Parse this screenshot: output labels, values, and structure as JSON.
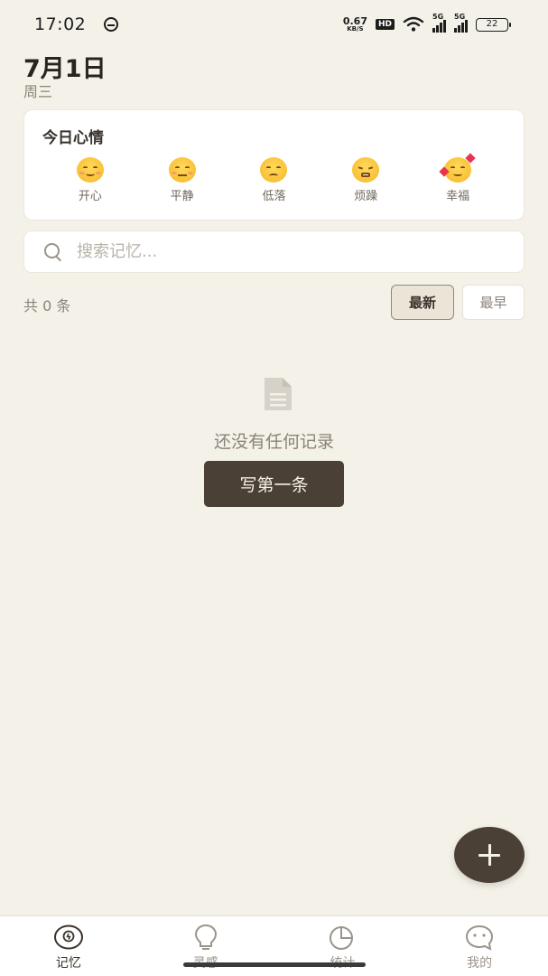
{
  "status_bar": {
    "time": "17:02",
    "net_speed": "0.67",
    "net_unit": "KB/S",
    "hd": "HD",
    "sig1": "5G",
    "sig2": "5G",
    "battery": "22"
  },
  "header": {
    "date": "7月1日",
    "weekday": "周三"
  },
  "mood": {
    "title": "今日心情",
    "items": [
      {
        "label": "开心",
        "icon": "smiling-face-icon"
      },
      {
        "label": "平静",
        "icon": "relieved-face-icon"
      },
      {
        "label": "低落",
        "icon": "pensive-face-icon"
      },
      {
        "label": "烦躁",
        "icon": "steam-face-icon"
      },
      {
        "label": "幸福",
        "icon": "hearts-face-icon"
      }
    ]
  },
  "search": {
    "placeholder": "搜索记忆...",
    "value": ""
  },
  "list": {
    "count_text": "共 0 条",
    "sort_latest": "最新",
    "sort_earliest": "最早",
    "selected_sort": "最新"
  },
  "empty_state": {
    "message": "还没有任何记录",
    "button": "写第一条"
  },
  "nav": {
    "items": [
      {
        "label": "记忆",
        "icon": "memory-icon",
        "active": true
      },
      {
        "label": "灵感",
        "icon": "lightbulb-icon",
        "active": false
      },
      {
        "label": "统计",
        "icon": "pie-chart-icon",
        "active": false
      },
      {
        "label": "我的",
        "icon": "profile-icon",
        "active": false
      }
    ]
  },
  "colors": {
    "background": "#f4f1e9",
    "accent": "#4b4036",
    "card": "#ffffff",
    "muted_text": "#8b837a"
  }
}
